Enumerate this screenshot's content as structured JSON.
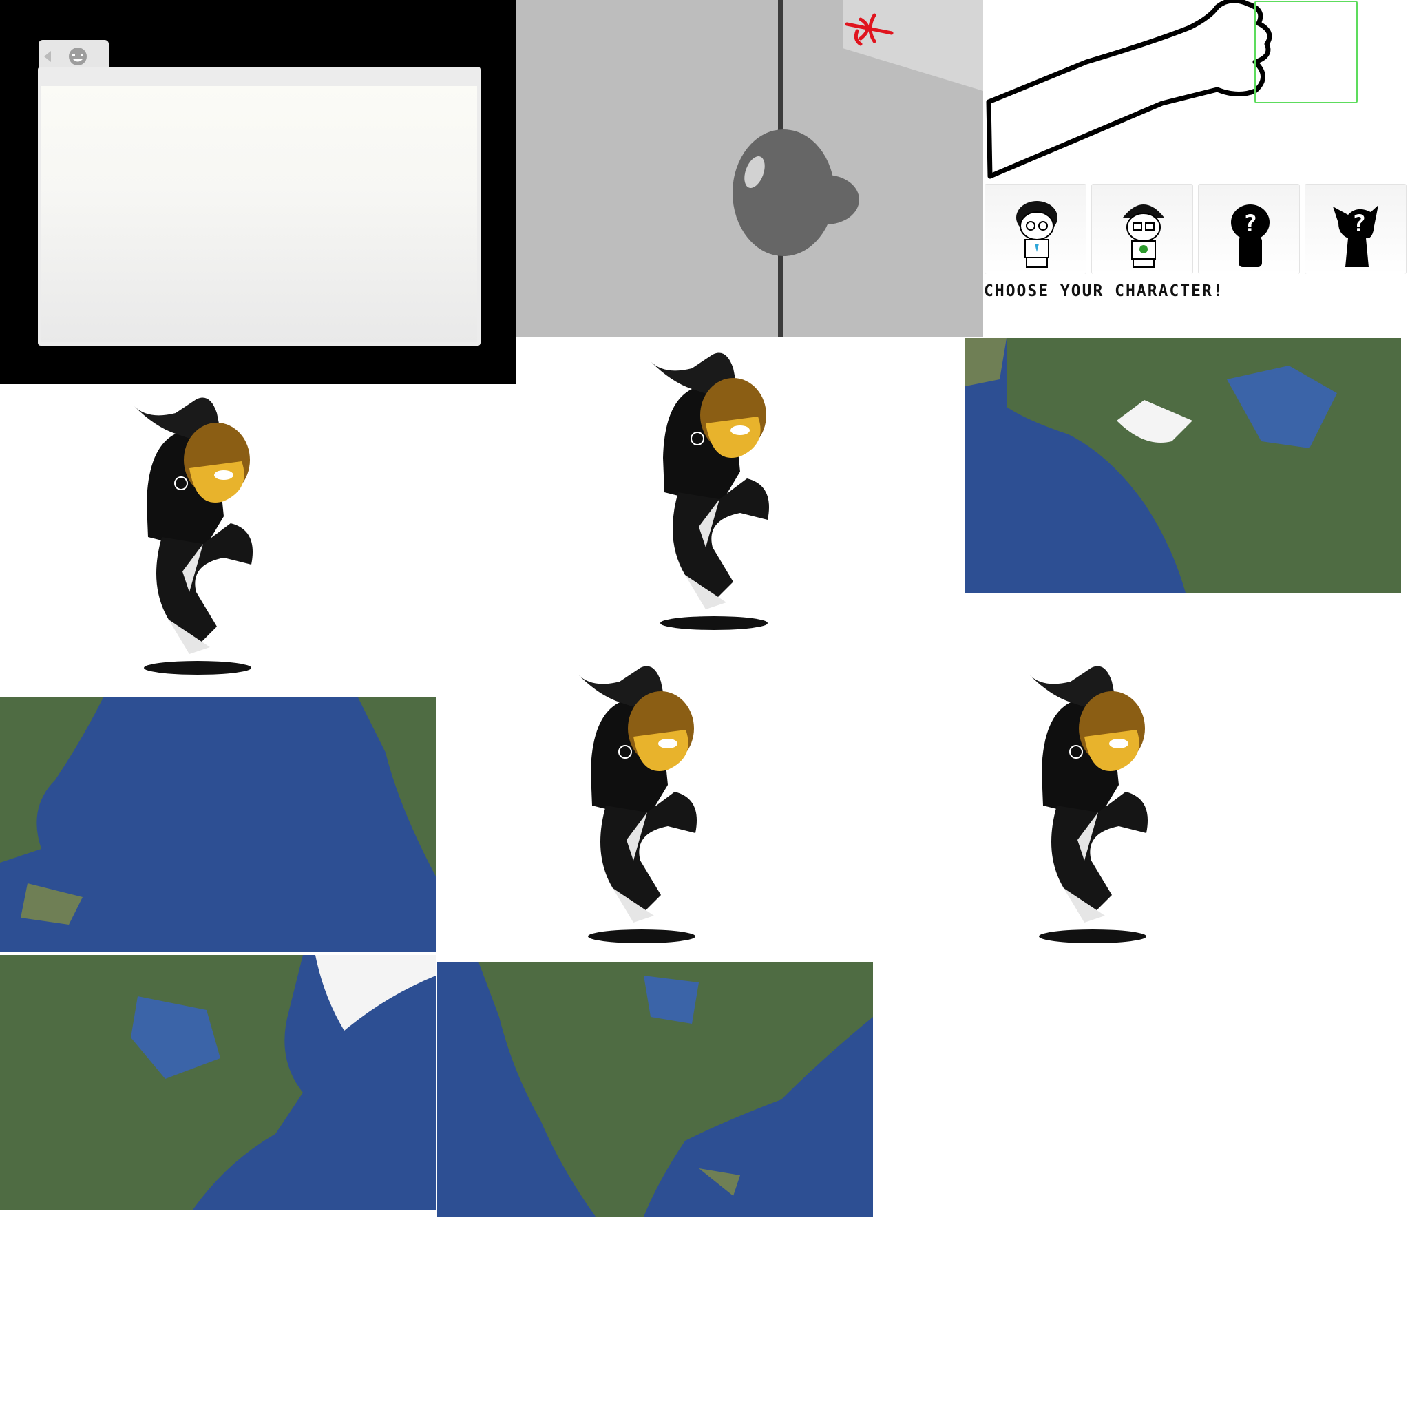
{
  "character_select": {
    "prompt": "CHOOSE YOUR CHARACTER!",
    "slots": [
      {
        "name": "boy-glasses",
        "icon": "character-portrait"
      },
      {
        "name": "boy-glasses-2",
        "icon": "character-portrait"
      },
      {
        "name": "unknown-1",
        "icon": "question-mark"
      },
      {
        "name": "unknown-2",
        "icon": "question-mark"
      }
    ],
    "unknown_mark": "?"
  },
  "colors": {
    "window_bg": "#000000",
    "door_wall": "#bdbdbd",
    "trident": "#e0141e",
    "select_outline": "#5ddc5d",
    "hood": "#111111",
    "hair": "#8b5e14",
    "face": "#e8b32c",
    "ocean": "#2d4f93",
    "land": "#4f6c43"
  },
  "sprites": {
    "dancer_frames": 4,
    "maps": [
      "alaska-canada",
      "pacific-ocean",
      "north-america-east",
      "north-america"
    ]
  }
}
